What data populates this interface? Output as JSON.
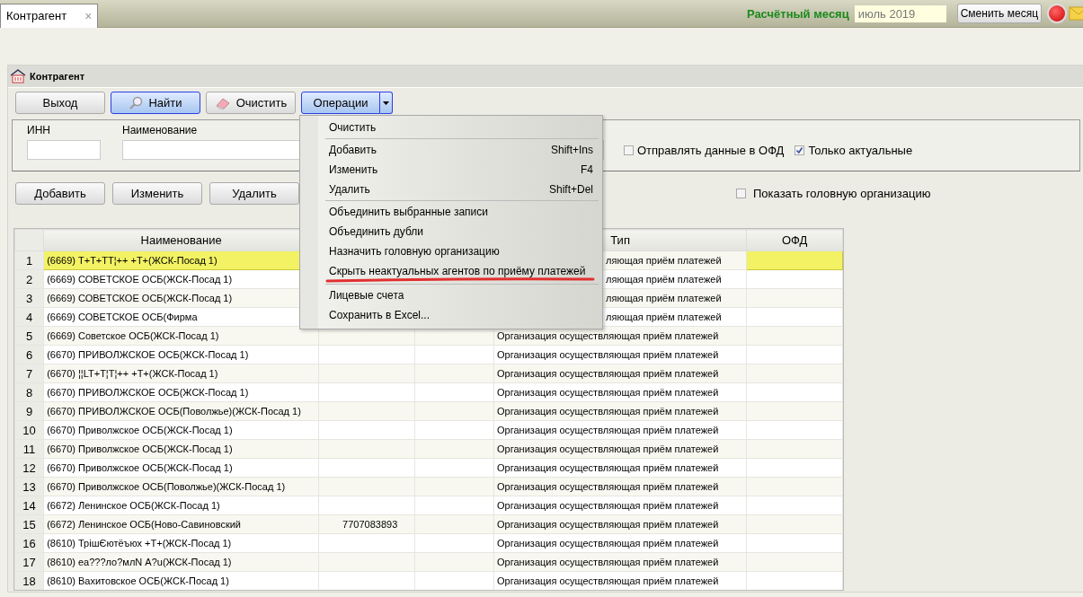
{
  "tabs": [
    {
      "label": "Контрагент",
      "selected": true,
      "close": "×"
    }
  ],
  "period": {
    "label": "Расчётный месяц",
    "value": "июль 2019",
    "button": "Сменить месяц"
  },
  "panel": {
    "title": "Контрагент"
  },
  "toolbar": [
    {
      "label": "Выход",
      "kind": "plain"
    },
    {
      "label": "Найти",
      "kind": "search"
    },
    {
      "label": "Очистить",
      "kind": "eraser"
    },
    {
      "label": "Операции",
      "kind": "dropdown",
      "expanded": true
    }
  ],
  "filters": {
    "fields": [
      {
        "label": "ИНН",
        "kind": "short"
      },
      {
        "label": "Наименование",
        "kind": "wide"
      }
    ],
    "checkboxes": [
      {
        "label": "Отправлять данные в ОФД",
        "checked": false
      },
      {
        "label": "Только актуальные",
        "checked": true
      }
    ]
  },
  "actions": [
    "Добавить",
    "Изменить",
    "Удалить"
  ],
  "head_checkbox": {
    "label": "Показать головную организацию",
    "checked": false
  },
  "menu": [
    {
      "kind": "item",
      "label": "Очистить"
    },
    {
      "kind": "separator"
    },
    {
      "kind": "item",
      "label": "Добавить",
      "shortcut": "Shift+Ins"
    },
    {
      "kind": "item",
      "label": "Изменить",
      "shortcut": "F4"
    },
    {
      "kind": "item",
      "label": "Удалить",
      "shortcut": "Shift+Del"
    },
    {
      "kind": "separator"
    },
    {
      "kind": "item",
      "label": "Объединить выбранные записи"
    },
    {
      "kind": "item",
      "label": "Объединить дубли"
    },
    {
      "kind": "item",
      "label": "Назначить головную организацию"
    },
    {
      "kind": "item",
      "label": "Скрыть неактуальных агентов по приёму платежей",
      "annotated": true
    },
    {
      "kind": "separator"
    },
    {
      "kind": "item",
      "label": "Лицевые счета"
    },
    {
      "kind": "item",
      "label": "Сохранить в Excel..."
    }
  ],
  "table": {
    "columns": [
      "Наименование",
      "",
      "",
      "Тип",
      "ОФД"
    ],
    "rows": [
      {
        "n": "1",
        "name": "(6669) Т+Т+ТТ¦++ +Т+(ЖСК-Посад 1)",
        "column_2": "",
        "type": "ляющая приём платежей",
        "covered": true,
        "selected": true
      },
      {
        "n": "2",
        "name": "(6669) СОВЕТСКОЕ ОСБ(ЖСК-Посад 1)",
        "column_2": "",
        "type": "ляющая приём платежей",
        "covered": true,
        "selected": false
      },
      {
        "n": "3",
        "name": "(6669) СОВЕТСКОЕ ОСБ(ЖСК-Посад 1)",
        "column_2": "",
        "type": "ляющая приём платежей",
        "covered": true,
        "selected": false
      },
      {
        "n": "4",
        "name": "(6669) СОВЕТСКОЕ ОСБ(Фирма",
        "column_2": "",
        "type": "ляющая приём платежей",
        "covered": true,
        "selected": false
      },
      {
        "n": "5",
        "name": "(6669) Советское ОСБ(ЖСК-Посад 1)",
        "column_2": "",
        "type": "Организация осуществляющая приём платежей",
        "covered": false,
        "selected": false
      },
      {
        "n": "6",
        "name": "(6670)  ПРИВОЛЖСКОЕ ОСБ(ЖСК-Посад 1)",
        "column_2": "",
        "type": "Организация осуществляющая приём платежей",
        "covered": false,
        "selected": false
      },
      {
        "n": "7",
        "name": "(6670) ¦¦LT+Т¦Т¦++ +Т+(ЖСК-Посад 1)",
        "column_2": "",
        "type": "Организация осуществляющая приём платежей",
        "covered": false,
        "selected": false
      },
      {
        "n": "8",
        "name": "(6670) ПРИВОЛЖСКОЕ ОСБ(ЖСК-Посад 1)",
        "column_2": "",
        "type": "Организация осуществляющая приём платежей",
        "covered": false,
        "selected": false
      },
      {
        "n": "9",
        "name": "(6670) ПРИВОЛЖСКОЕ ОСБ(Поволжье)(ЖСК-Посад 1)",
        "column_2": "",
        "type": "Организация осуществляющая приём платежей",
        "covered": false,
        "selected": false
      },
      {
        "n": "10",
        "name": "(6670) Приволжское ОСБ(ЖСК-Посад 1)",
        "column_2": "",
        "type": "Организация осуществляющая приём платежей",
        "covered": false,
        "selected": false
      },
      {
        "n": "11",
        "name": "(6670) Приволжское ОСБ(ЖСК-Посад 1)",
        "column_2": "",
        "type": "Организация осуществляющая приём платежей",
        "covered": false,
        "selected": false
      },
      {
        "n": "12",
        "name": "(6670) Приволжское ОСБ(ЖСК-Посад 1)",
        "column_2": "",
        "type": "Организация осуществляющая приём платежей",
        "covered": false,
        "selected": false
      },
      {
        "n": "13",
        "name": "(6670) Приволжское ОСБ(Поволжье)(ЖСК-Посад 1)",
        "column_2": "",
        "type": "Организация осуществляющая приём платежей",
        "covered": false,
        "selected": false
      },
      {
        "n": "14",
        "name": "(6672) Ленинское ОСБ(ЖСК-Посад 1)",
        "column_2": "",
        "type": "Организация осуществляющая приём платежей",
        "covered": false,
        "selected": false
      },
      {
        "n": "15",
        "name": "(6672) Ленинское ОСБ(Ново-Савиновский",
        "column_2": "7707083893",
        "type": "Организация осуществляющая приём платежей",
        "covered": false,
        "selected": false
      },
      {
        "n": "16",
        "name": "(8610) ТрішЄютёъюх +Т+(ЖСК-Посад 1)",
        "column_2": "",
        "type": "Организация осуществляющая приём платежей",
        "covered": false,
        "selected": false
      },
      {
        "n": "17",
        "name": "(8610) еа???ло?млN А?u(ЖСК-Посад 1)",
        "column_2": "",
        "type": "Организация осуществляющая приём платежей",
        "covered": false,
        "selected": false
      },
      {
        "n": "18",
        "name": "(8610) Вахитовское ОСБ(ЖСК-Посад 1)",
        "column_2": "",
        "type": "Организация осуществляющая приём платежей",
        "covered": false,
        "selected": false
      }
    ]
  }
}
